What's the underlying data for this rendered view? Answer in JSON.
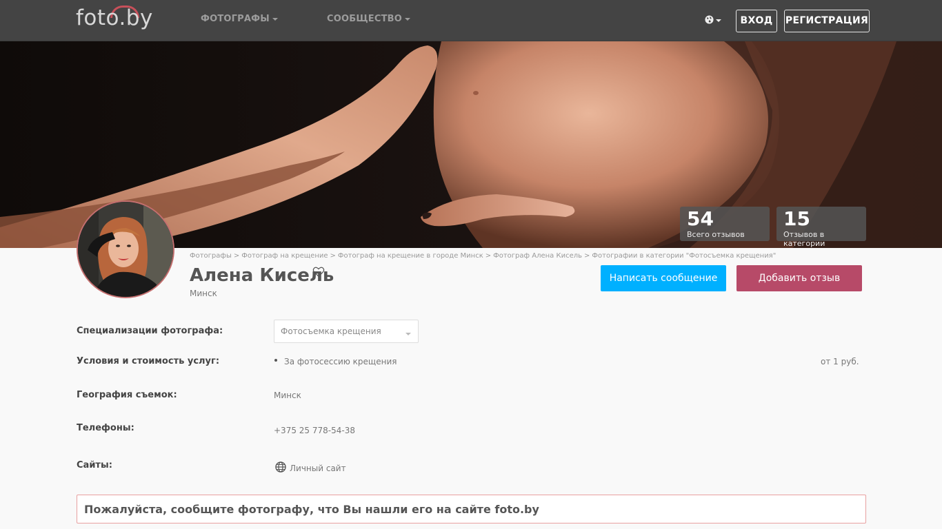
{
  "header": {
    "logo_text": "foto.by",
    "nav": [
      {
        "label": "ФОТОГРАФЫ"
      },
      {
        "label": "СООБЩЕСТВО"
      }
    ],
    "login_label": "ВХОД",
    "register_label": "РЕГИСТРАЦИЯ",
    "language_icon": "globe-icon"
  },
  "stats": [
    {
      "value": "54",
      "label": "Всего отзывов"
    },
    {
      "value": "15",
      "label": "Отзывов в категории"
    }
  ],
  "breadcrumb": [
    "Фотографы",
    "Фотограф на крещение",
    "Фотограф на крещение в городе Минск",
    "Фотограф Алена Кисель",
    "Фотографии в категории \"Фотосъемка крещения\""
  ],
  "breadcrumb_separator": ">",
  "profile": {
    "name": "Алена Кисель",
    "city": "Минск",
    "favorite_icon": "heart-icon"
  },
  "actions": {
    "message_label": "Написать сообщение",
    "review_label": "Добавить отзыв"
  },
  "info": {
    "specializations": {
      "label": "Специализации фотографа:",
      "selected": "Фотосъемка крещения"
    },
    "services": {
      "label": "Условия и стоимость услуг:",
      "items": [
        {
          "name": "За фотосессию крещения",
          "price": "от 1 руб."
        }
      ]
    },
    "geography": {
      "label": "География съемок:",
      "value": "Минск"
    },
    "phones": {
      "label": "Телефоны:",
      "value": "+375 25 778-54-38"
    },
    "sites": {
      "label": "Сайты:",
      "link_label": "Личный сайт"
    }
  },
  "notice": "Пожалуйста, сообщите фотографу, что Вы нашли его на сайте foto.by",
  "colors": {
    "header_bg": "#444444",
    "message_button": "#00b0ff",
    "review_button": "#b74a68",
    "notice_border": "#e8a0a0"
  }
}
